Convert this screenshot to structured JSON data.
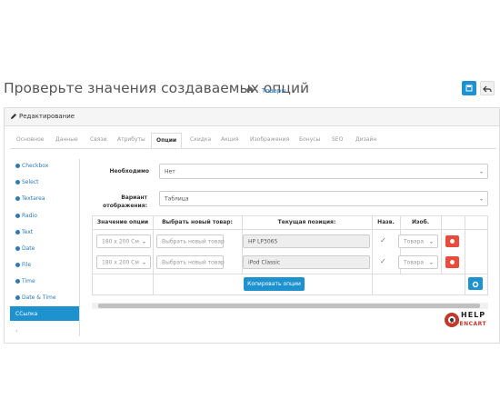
{
  "header": {
    "title": "Проверьте значения создаваемых опций",
    "breadcrumb": [
      "Товары"
    ]
  },
  "panel": {
    "title": "Редактирование"
  },
  "tabs": [
    {
      "label": "Основное"
    },
    {
      "label": "Данные"
    },
    {
      "label": "Связи"
    },
    {
      "label": "Атрибуты"
    },
    {
      "label": "Опции",
      "active": true
    },
    {
      "label": "Скидка"
    },
    {
      "label": "Акция"
    },
    {
      "label": "Изображения"
    },
    {
      "label": "Бонусы"
    },
    {
      "label": "SEO"
    },
    {
      "label": "Дизайн"
    }
  ],
  "sidebar": {
    "items": [
      {
        "label": "Checkbox"
      },
      {
        "label": "Select"
      },
      {
        "label": "Textarea"
      },
      {
        "label": "Radio"
      },
      {
        "label": "Text"
      },
      {
        "label": "Date"
      },
      {
        "label": "File"
      },
      {
        "label": "Time"
      },
      {
        "label": "Date & Time"
      },
      {
        "label": "ССылка",
        "active": true
      }
    ]
  },
  "form": {
    "required_label": "Необходимо",
    "required_value": "Нет",
    "display_label": "Вариант отображения:",
    "display_value": "Таблица"
  },
  "table": {
    "headers": [
      "Значение опции",
      "Выбрать новый товар:",
      "Текущая позиция:",
      "Назв.",
      "Изоб."
    ],
    "rows": [
      {
        "option_value": "180 х 200 См",
        "new_product_placeholder": "Выбрать новый товар",
        "current": "HP LP3065",
        "image": "Товара"
      },
      {
        "option_value": "180 х 200 См",
        "new_product_placeholder": "Выбрать новый товар",
        "current": "iPod Classic",
        "image": "Товара"
      }
    ],
    "copy_button": "Копировать опции"
  },
  "watermark": {
    "line1": "HELP",
    "line2": "OPENCART"
  },
  "colors": {
    "primary": "#1e91cf",
    "danger": "#e74c3c"
  }
}
